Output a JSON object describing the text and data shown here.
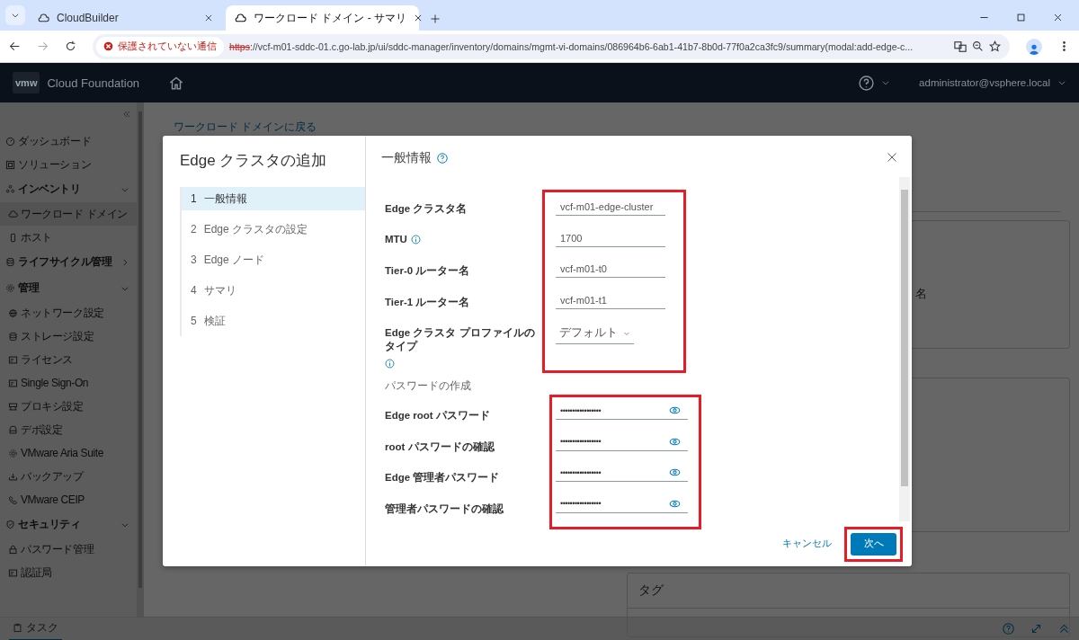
{
  "browser": {
    "tabs": [
      {
        "title": "CloudBuilder",
        "selected": false
      },
      {
        "title": "ワークロード ドメイン - サマリ",
        "selected": true
      }
    ],
    "security_chip": "保護されていない通信",
    "url_scheme": "https",
    "url_rest": "://vcf-m01-sddc-01.c.go-lab.jp/ui/sddc-manager/inventory/domains/mgmt-vi-domains/086964b6-6ab1-41b7-8b0d-77f0a2ca3fc9/summary(modal:add-edge-c..."
  },
  "header": {
    "logo": "vmw",
    "product": "Cloud Foundation",
    "user": "administrator@vsphere.local"
  },
  "sidebar": {
    "items": [
      {
        "label": "ダッシュボード"
      },
      {
        "label": "ソリューション"
      },
      {
        "label": "インベントリ",
        "expanded": true,
        "children": [
          {
            "label": "ワークロード ドメイン",
            "selected": true
          },
          {
            "label": "ホスト",
            "selected": false
          }
        ]
      },
      {
        "label": "ライフサイクル管理",
        "expanded": false
      },
      {
        "label": "管理",
        "expanded": true,
        "children": [
          {
            "label": "ネットワーク設定",
            "selected": false
          },
          {
            "label": "ストレージ設定",
            "selected": false
          },
          {
            "label": "ライセンス",
            "selected": false
          },
          {
            "label": "Single Sign-On",
            "selected": false
          },
          {
            "label": "プロキシ設定",
            "selected": false
          },
          {
            "label": "デポ設定",
            "selected": false
          },
          {
            "label": "VMware Aria Suite",
            "selected": false
          },
          {
            "label": "バックアップ",
            "selected": false
          },
          {
            "label": "VMware CEIP",
            "selected": false
          }
        ]
      },
      {
        "label": "セキュリティ",
        "expanded": true,
        "children": [
          {
            "label": "パスワード管理",
            "selected": false
          },
          {
            "label": "認証局",
            "selected": false
          }
        ]
      }
    ]
  },
  "back_link": "ワークロード ドメインに戻る",
  "background": {
    "card_text": "名",
    "tags_title": "タグ"
  },
  "modal": {
    "title": "Edge クラスタの追加",
    "steps": [
      {
        "number": "1",
        "label": "一般情報",
        "selected": true
      },
      {
        "number": "2",
        "label": "Edge クラスタの設定",
        "selected": false
      },
      {
        "number": "3",
        "label": "Edge ノード",
        "selected": false
      },
      {
        "number": "4",
        "label": "サマリ",
        "selected": false
      },
      {
        "number": "5",
        "label": "検証",
        "selected": false
      }
    ],
    "heading": "一般情報",
    "general_fields": [
      {
        "label": "Edge クラスタ名",
        "kind": "text",
        "value": "vcf-m01-edge-cluster",
        "info": false
      },
      {
        "label": "MTU",
        "kind": "text",
        "value": "1700",
        "info": true
      },
      {
        "label": "Tier-0 ルーター名",
        "kind": "text",
        "value": "vcf-m01-t0",
        "info": false
      },
      {
        "label": "Tier-1 ルーター名",
        "kind": "text",
        "value": "vcf-m01-t1",
        "info": false
      },
      {
        "label": "Edge クラスタ プロファイルのタイプ",
        "kind": "select",
        "value": "デフォルト",
        "info": true
      }
    ],
    "password_heading": "パスワードの作成",
    "password_fields": [
      {
        "label": "Edge root パスワード",
        "value": "•••••••••••••••••"
      },
      {
        "label": "root パスワードの確認",
        "value": "•••••••••••••••••"
      },
      {
        "label": "Edge 管理者パスワード",
        "value": "•••••••••••••••••"
      },
      {
        "label": "管理者パスワードの確認",
        "value": "•••••••••••••••••"
      }
    ],
    "cancel": "キャンセル",
    "next": "次へ"
  },
  "taskbar": {
    "label": "タスク"
  }
}
